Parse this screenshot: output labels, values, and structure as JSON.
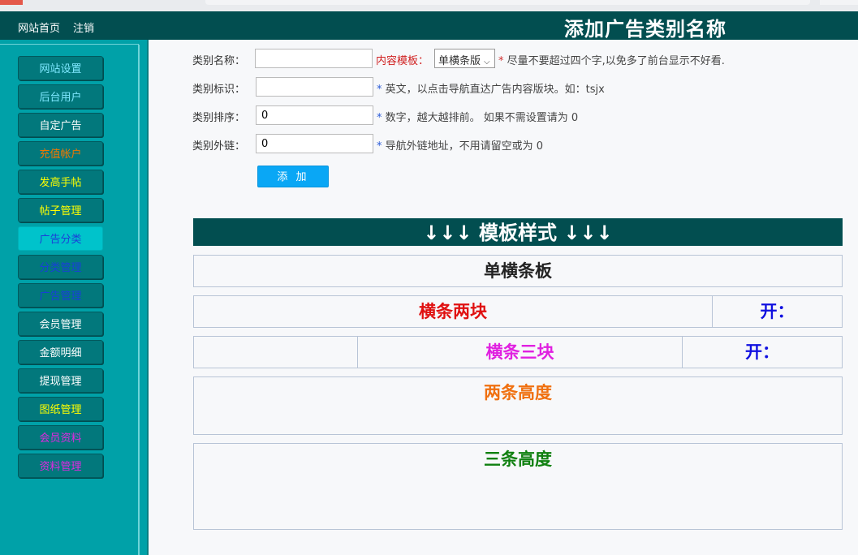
{
  "top_nav": {
    "home": "网站首页",
    "logout": "注销"
  },
  "page_title": "添加广告类别名称",
  "sidebar": {
    "items": [
      {
        "label": "网站设置",
        "color": "#7fe8ff"
      },
      {
        "label": "后台用户",
        "color": "#7fe8ff"
      },
      {
        "label": "自定广告",
        "color": "#ffffff"
      },
      {
        "label": "充值帐户",
        "color": "#f07800"
      },
      {
        "label": "发高手帖",
        "color": "#ffff00"
      },
      {
        "label": "帖子管理",
        "color": "#ffff00"
      },
      {
        "label": "广告分类",
        "color": "#1a3fd8"
      },
      {
        "label": "分类管理",
        "color": "#1a3fd8"
      },
      {
        "label": "广告管理",
        "color": "#1a3fd8"
      },
      {
        "label": "会员管理",
        "color": "#ffffff"
      },
      {
        "label": "金额明细",
        "color": "#ffffff"
      },
      {
        "label": "提现管理",
        "color": "#ffffff"
      },
      {
        "label": "图纸管理",
        "color": "#ffff00"
      },
      {
        "label": "会员资料",
        "color": "#e028e0"
      },
      {
        "label": "资料管理",
        "color": "#e028e0"
      }
    ],
    "active": "广告分类"
  },
  "form": {
    "name_label": "类别名称：",
    "name_value": "",
    "template_label": "内容模板：",
    "template_selected": "单横条版",
    "name_hint_star": "*",
    "name_hint": " 尽量不要超过四个字,以免多了前台显示不好看.",
    "id_label": "类别标识：",
    "id_value": "",
    "id_hint_star": "*",
    "id_hint": " 英文，以点击导航直达广告内容版块。如：tsjx",
    "sort_label": "类别排序：",
    "sort_value": "0",
    "sort_hint_star": "*",
    "sort_hint": " 数字，越大越排前。 如果不需设置请为 0",
    "link_label": "类别外链：",
    "link_value": "0",
    "link_hint_star": "*",
    "link_hint": " 导航外链地址，不用请留空或为 0",
    "add_button": "添 加"
  },
  "templates": {
    "header": "↓↓↓ 模板样式 ↓↓↓",
    "single": {
      "label": "单横条板",
      "color": "#222222"
    },
    "two_blocks": {
      "label": "横条两块",
      "side": "开：",
      "color": "#e01010",
      "side_color": "#1010e0"
    },
    "three_blocks": {
      "left": "",
      "label": "横条三块",
      "side": "开：",
      "color": "#e020e0",
      "side_color": "#1010e0"
    },
    "two_height": {
      "label": "两条高度",
      "color": "#f07010"
    },
    "three_height": {
      "label": "三条高度",
      "color": "#108010"
    }
  }
}
